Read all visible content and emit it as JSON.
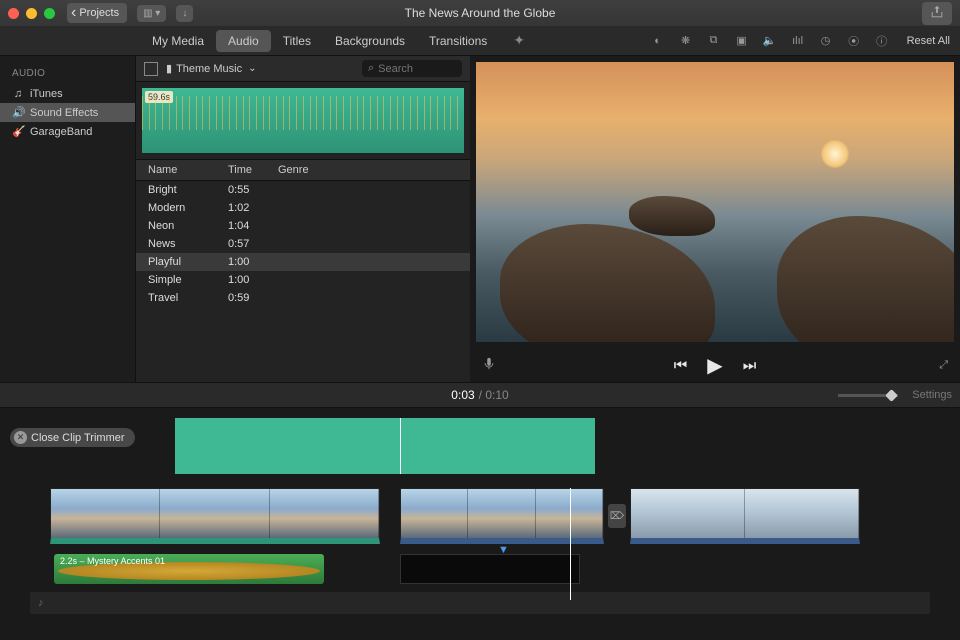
{
  "window": {
    "title": "The News Around the Globe",
    "back_label": "Projects"
  },
  "tabs": {
    "my_media": "My Media",
    "audio": "Audio",
    "titles": "Titles",
    "backgrounds": "Backgrounds",
    "transitions": "Transitions"
  },
  "reset_all": "Reset All",
  "sidebar": {
    "header": "AUDIO",
    "items": [
      {
        "label": "iTunes",
        "icon": "♫"
      },
      {
        "label": "Sound Effects",
        "icon": "🔊"
      },
      {
        "label": "GarageBand",
        "icon": "🎸"
      }
    ]
  },
  "browser": {
    "crumb": "Theme Music",
    "search_placeholder": "Search",
    "waveform_duration": "59.6s",
    "columns": {
      "name": "Name",
      "time": "Time",
      "genre": "Genre"
    },
    "tracks": [
      {
        "name": "Bright",
        "time": "0:55"
      },
      {
        "name": "Modern",
        "time": "1:02"
      },
      {
        "name": "Neon",
        "time": "1:04"
      },
      {
        "name": "News",
        "time": "0:57"
      },
      {
        "name": "Playful",
        "time": "1:00"
      },
      {
        "name": "Simple",
        "time": "1:00"
      },
      {
        "name": "Travel",
        "time": "0:59"
      }
    ],
    "selected_index": 4
  },
  "playback": {
    "current": "0:03",
    "total": "0:10"
  },
  "settings_label": "Settings",
  "timeline": {
    "close_trimmer": "Close Clip Trimmer",
    "audio_clip_label": "2.2s – Mystery Accents 01"
  }
}
